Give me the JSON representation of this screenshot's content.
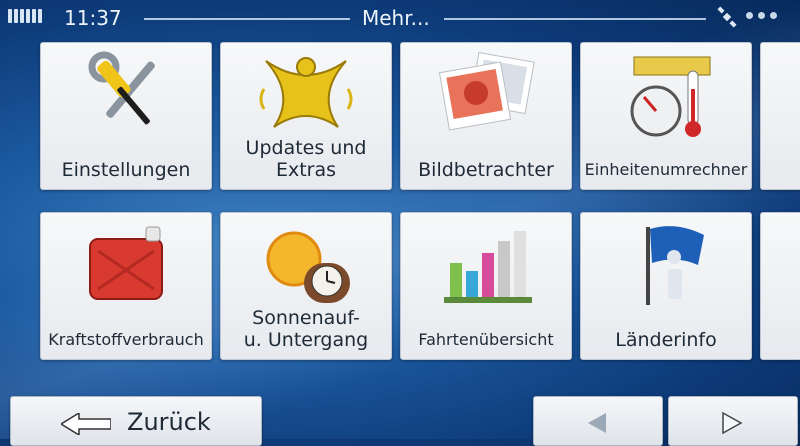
{
  "status": {
    "time": "11:37",
    "title": "Mehr..."
  },
  "tiles": [
    {
      "label": "Einstellungen",
      "icon": "tools-icon"
    },
    {
      "label": "Updates und\nExtras",
      "icon": "updates-extras-icon"
    },
    {
      "label": "Bildbetrachter",
      "icon": "photos-icon"
    },
    {
      "label": "Einheitenumrechner",
      "icon": "unit-converter-icon"
    },
    {
      "label": "Kraftstoffverbrauch",
      "icon": "fuel-can-icon"
    },
    {
      "label": "Sonnenauf-\nu. Untergang",
      "icon": "sun-clock-icon"
    },
    {
      "label": "Fahrtenübersicht",
      "icon": "bar-chart-icon"
    },
    {
      "label": "Länderinfo",
      "icon": "info-flag-icon"
    }
  ],
  "nav": {
    "back_label": "Zurück",
    "prev_icon": "arrow-left-icon",
    "next_icon": "arrow-right-icon"
  },
  "colors": {
    "background": "#1c5aa0",
    "tile": "#f2f4f6",
    "text": "#1e2a36"
  }
}
